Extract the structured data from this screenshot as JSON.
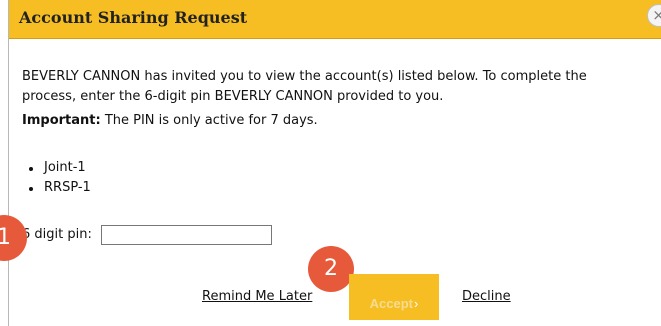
{
  "dialog": {
    "title": "Account Sharing Request",
    "close_icon": "close-icon",
    "close_symbol": "×"
  },
  "message": {
    "invite_text": "BEVERLY CANNON has invited you to view the account(s) listed below. To complete the process, enter the 6-digit pin BEVERLY CANNON provided to you.",
    "important_label": "Important:",
    "important_text": " The PIN is only active for 7 days."
  },
  "accounts": [
    "Joint-1",
    "RRSP-1"
  ],
  "pin": {
    "label": "6 digit pin:",
    "value": ""
  },
  "callouts": [
    "1",
    "2"
  ],
  "actions": {
    "remind_label": "Remind Me Later",
    "accept_label": "Accept",
    "accept_arrow": "›",
    "decline_label": "Decline"
  },
  "colors": {
    "title_bar": "#f6be22",
    "accept_button": "#f6be22",
    "callout": "#e65a3b"
  }
}
